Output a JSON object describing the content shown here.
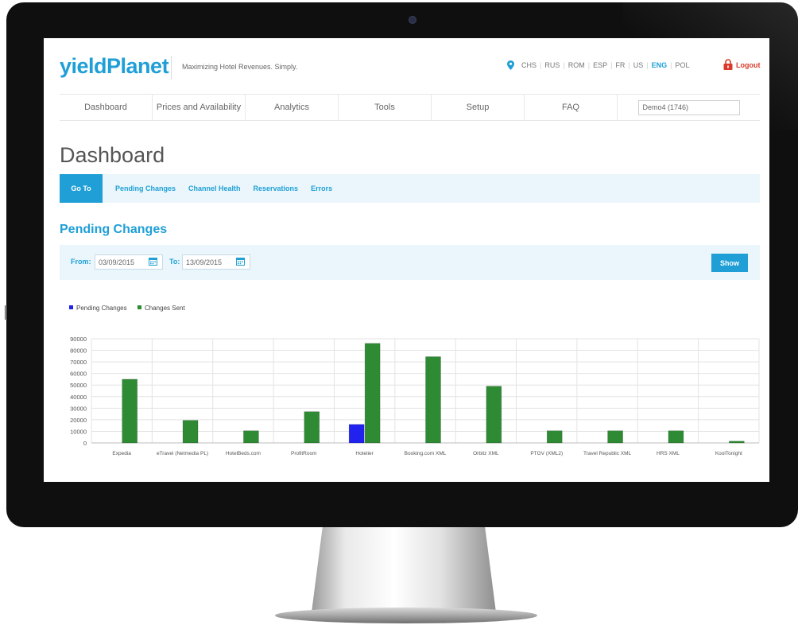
{
  "header": {
    "logo": "yieldPlanet",
    "tagline": "Maximizing Hotel Revenues. Simply.",
    "languages": [
      {
        "code": "CHS",
        "active": false
      },
      {
        "code": "RUS",
        "active": false
      },
      {
        "code": "ROM",
        "active": false
      },
      {
        "code": "ESP",
        "active": false
      },
      {
        "code": "FR",
        "active": false
      },
      {
        "code": "US",
        "active": false
      },
      {
        "code": "ENG",
        "active": true
      },
      {
        "code": "POL",
        "active": false
      }
    ],
    "logout_label": "Logout"
  },
  "nav": {
    "items": [
      "Dashboard",
      "Prices and Availability",
      "Analytics",
      "Tools",
      "Setup",
      "FAQ"
    ],
    "hotel_select_value": "Demo4 (1746)"
  },
  "page": {
    "title": "Dashboard",
    "subnav": {
      "goto_label": "Go To",
      "links": [
        "Pending Changes",
        "Channel Health",
        "Reservations",
        "Errors"
      ]
    },
    "section_title": "Pending Changes",
    "filter": {
      "from_label": "From:",
      "from_value": "03/09/2015",
      "to_label": "To:",
      "to_value": "13/09/2015",
      "show_label": "Show"
    }
  },
  "colors": {
    "brand": "#1f9fd6",
    "pending": "#2222ee",
    "sent": "#2e8b34",
    "logout": "#d93a2b"
  },
  "chart_data": {
    "type": "bar",
    "categories": [
      "Expedia",
      "eTravel (Netmedia PL)",
      "HotelBeds.com",
      "ProfitRoom",
      "Hotelier",
      "Booking.com XML",
      "Orbitz XML",
      "PTGV (XML2)",
      "Travel Republic XML",
      "HRS XML",
      "KoolTonight"
    ],
    "series": [
      {
        "name": "Pending Changes",
        "color": "#2222ee",
        "values": [
          0,
          0,
          0,
          0,
          16000,
          0,
          0,
          0,
          0,
          0,
          0
        ]
      },
      {
        "name": "Changes Sent",
        "color": "#2e8b34",
        "values": [
          55000,
          19500,
          10500,
          27000,
          86000,
          74500,
          49000,
          10500,
          10500,
          10500,
          1500
        ]
      }
    ],
    "ylim": [
      0,
      90000
    ],
    "yticks": [
      0,
      10000,
      20000,
      30000,
      40000,
      50000,
      60000,
      70000,
      80000,
      90000
    ],
    "grid": true,
    "legend_position": "top-left"
  }
}
